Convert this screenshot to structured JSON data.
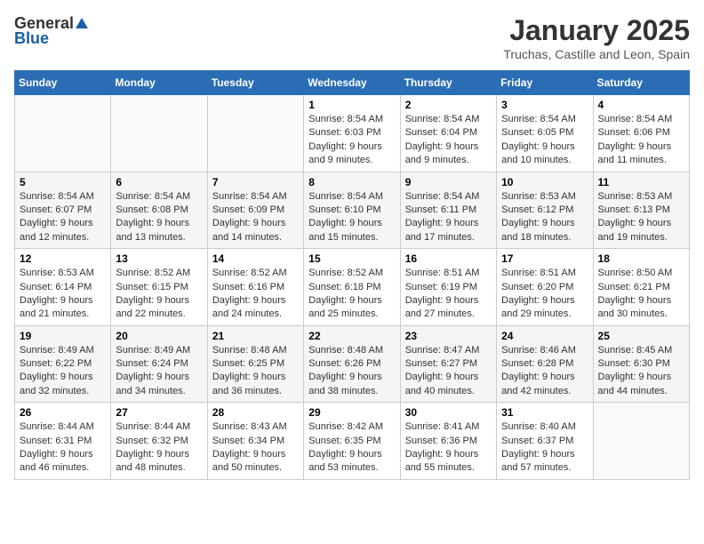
{
  "header": {
    "logo_general": "General",
    "logo_blue": "Blue",
    "title": "January 2025",
    "subtitle": "Truchas, Castille and Leon, Spain"
  },
  "weekdays": [
    "Sunday",
    "Monday",
    "Tuesday",
    "Wednesday",
    "Thursday",
    "Friday",
    "Saturday"
  ],
  "weeks": [
    {
      "days": [
        {
          "num": "",
          "info": ""
        },
        {
          "num": "",
          "info": ""
        },
        {
          "num": "",
          "info": ""
        },
        {
          "num": "1",
          "info": "Sunrise: 8:54 AM\nSunset: 6:03 PM\nDaylight: 9 hours\nand 9 minutes."
        },
        {
          "num": "2",
          "info": "Sunrise: 8:54 AM\nSunset: 6:04 PM\nDaylight: 9 hours\nand 9 minutes."
        },
        {
          "num": "3",
          "info": "Sunrise: 8:54 AM\nSunset: 6:05 PM\nDaylight: 9 hours\nand 10 minutes."
        },
        {
          "num": "4",
          "info": "Sunrise: 8:54 AM\nSunset: 6:06 PM\nDaylight: 9 hours\nand 11 minutes."
        }
      ]
    },
    {
      "days": [
        {
          "num": "5",
          "info": "Sunrise: 8:54 AM\nSunset: 6:07 PM\nDaylight: 9 hours\nand 12 minutes."
        },
        {
          "num": "6",
          "info": "Sunrise: 8:54 AM\nSunset: 6:08 PM\nDaylight: 9 hours\nand 13 minutes."
        },
        {
          "num": "7",
          "info": "Sunrise: 8:54 AM\nSunset: 6:09 PM\nDaylight: 9 hours\nand 14 minutes."
        },
        {
          "num": "8",
          "info": "Sunrise: 8:54 AM\nSunset: 6:10 PM\nDaylight: 9 hours\nand 15 minutes."
        },
        {
          "num": "9",
          "info": "Sunrise: 8:54 AM\nSunset: 6:11 PM\nDaylight: 9 hours\nand 17 minutes."
        },
        {
          "num": "10",
          "info": "Sunrise: 8:53 AM\nSunset: 6:12 PM\nDaylight: 9 hours\nand 18 minutes."
        },
        {
          "num": "11",
          "info": "Sunrise: 8:53 AM\nSunset: 6:13 PM\nDaylight: 9 hours\nand 19 minutes."
        }
      ]
    },
    {
      "days": [
        {
          "num": "12",
          "info": "Sunrise: 8:53 AM\nSunset: 6:14 PM\nDaylight: 9 hours\nand 21 minutes."
        },
        {
          "num": "13",
          "info": "Sunrise: 8:52 AM\nSunset: 6:15 PM\nDaylight: 9 hours\nand 22 minutes."
        },
        {
          "num": "14",
          "info": "Sunrise: 8:52 AM\nSunset: 6:16 PM\nDaylight: 9 hours\nand 24 minutes."
        },
        {
          "num": "15",
          "info": "Sunrise: 8:52 AM\nSunset: 6:18 PM\nDaylight: 9 hours\nand 25 minutes."
        },
        {
          "num": "16",
          "info": "Sunrise: 8:51 AM\nSunset: 6:19 PM\nDaylight: 9 hours\nand 27 minutes."
        },
        {
          "num": "17",
          "info": "Sunrise: 8:51 AM\nSunset: 6:20 PM\nDaylight: 9 hours\nand 29 minutes."
        },
        {
          "num": "18",
          "info": "Sunrise: 8:50 AM\nSunset: 6:21 PM\nDaylight: 9 hours\nand 30 minutes."
        }
      ]
    },
    {
      "days": [
        {
          "num": "19",
          "info": "Sunrise: 8:49 AM\nSunset: 6:22 PM\nDaylight: 9 hours\nand 32 minutes."
        },
        {
          "num": "20",
          "info": "Sunrise: 8:49 AM\nSunset: 6:24 PM\nDaylight: 9 hours\nand 34 minutes."
        },
        {
          "num": "21",
          "info": "Sunrise: 8:48 AM\nSunset: 6:25 PM\nDaylight: 9 hours\nand 36 minutes."
        },
        {
          "num": "22",
          "info": "Sunrise: 8:48 AM\nSunset: 6:26 PM\nDaylight: 9 hours\nand 38 minutes."
        },
        {
          "num": "23",
          "info": "Sunrise: 8:47 AM\nSunset: 6:27 PM\nDaylight: 9 hours\nand 40 minutes."
        },
        {
          "num": "24",
          "info": "Sunrise: 8:46 AM\nSunset: 6:28 PM\nDaylight: 9 hours\nand 42 minutes."
        },
        {
          "num": "25",
          "info": "Sunrise: 8:45 AM\nSunset: 6:30 PM\nDaylight: 9 hours\nand 44 minutes."
        }
      ]
    },
    {
      "days": [
        {
          "num": "26",
          "info": "Sunrise: 8:44 AM\nSunset: 6:31 PM\nDaylight: 9 hours\nand 46 minutes."
        },
        {
          "num": "27",
          "info": "Sunrise: 8:44 AM\nSunset: 6:32 PM\nDaylight: 9 hours\nand 48 minutes."
        },
        {
          "num": "28",
          "info": "Sunrise: 8:43 AM\nSunset: 6:34 PM\nDaylight: 9 hours\nand 50 minutes."
        },
        {
          "num": "29",
          "info": "Sunrise: 8:42 AM\nSunset: 6:35 PM\nDaylight: 9 hours\nand 53 minutes."
        },
        {
          "num": "30",
          "info": "Sunrise: 8:41 AM\nSunset: 6:36 PM\nDaylight: 9 hours\nand 55 minutes."
        },
        {
          "num": "31",
          "info": "Sunrise: 8:40 AM\nSunset: 6:37 PM\nDaylight: 9 hours\nand 57 minutes."
        },
        {
          "num": "",
          "info": ""
        }
      ]
    }
  ]
}
